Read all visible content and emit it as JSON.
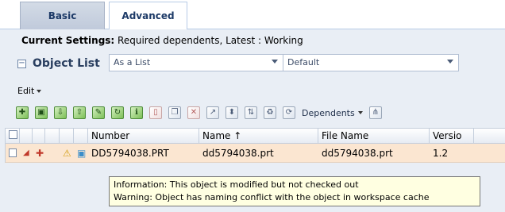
{
  "tabs": [
    {
      "label": "Basic"
    },
    {
      "label": "Advanced"
    }
  ],
  "settings": {
    "label": "Current Settings:",
    "value": " Required dependents, Latest : Working"
  },
  "object_list": {
    "collapse_symbol": "−",
    "title": "Object List",
    "view_select": "As a List",
    "filter_select": "Default"
  },
  "edit_menu": "Edit",
  "toolbar": {
    "icons": [
      "add-icon",
      "workspace-icon",
      "checkout-icon",
      "checkin-icon",
      "revise-icon",
      "update-icon",
      "info-icon",
      "delete-icon",
      "copy-icon",
      "cancel-icon",
      "new-icon",
      "navigate-icon",
      "sort-icon",
      "refresh-icon",
      "recycle-icon"
    ],
    "dependents_label": "Dependents"
  },
  "table": {
    "headers": [
      "",
      "",
      "",
      "",
      "",
      "",
      "Number",
      "Name ↑",
      "File Name",
      "Versio"
    ],
    "rows": [
      {
        "number": "DD5794038.PRT",
        "name": "dd5794038.prt",
        "file_name": "dd5794038.prt",
        "version": "1.2"
      }
    ]
  },
  "tooltip": {
    "line1": "Information: This object is modified but not checked out",
    "line2": "Warning: Object has naming conflict with the object in workspace cache"
  },
  "colors": {
    "tab_text": "#1d3a67",
    "panel_bg": "#e9eef5",
    "row_highlight": "#fbe6d1",
    "tooltip_bg": "#ffffe1"
  }
}
